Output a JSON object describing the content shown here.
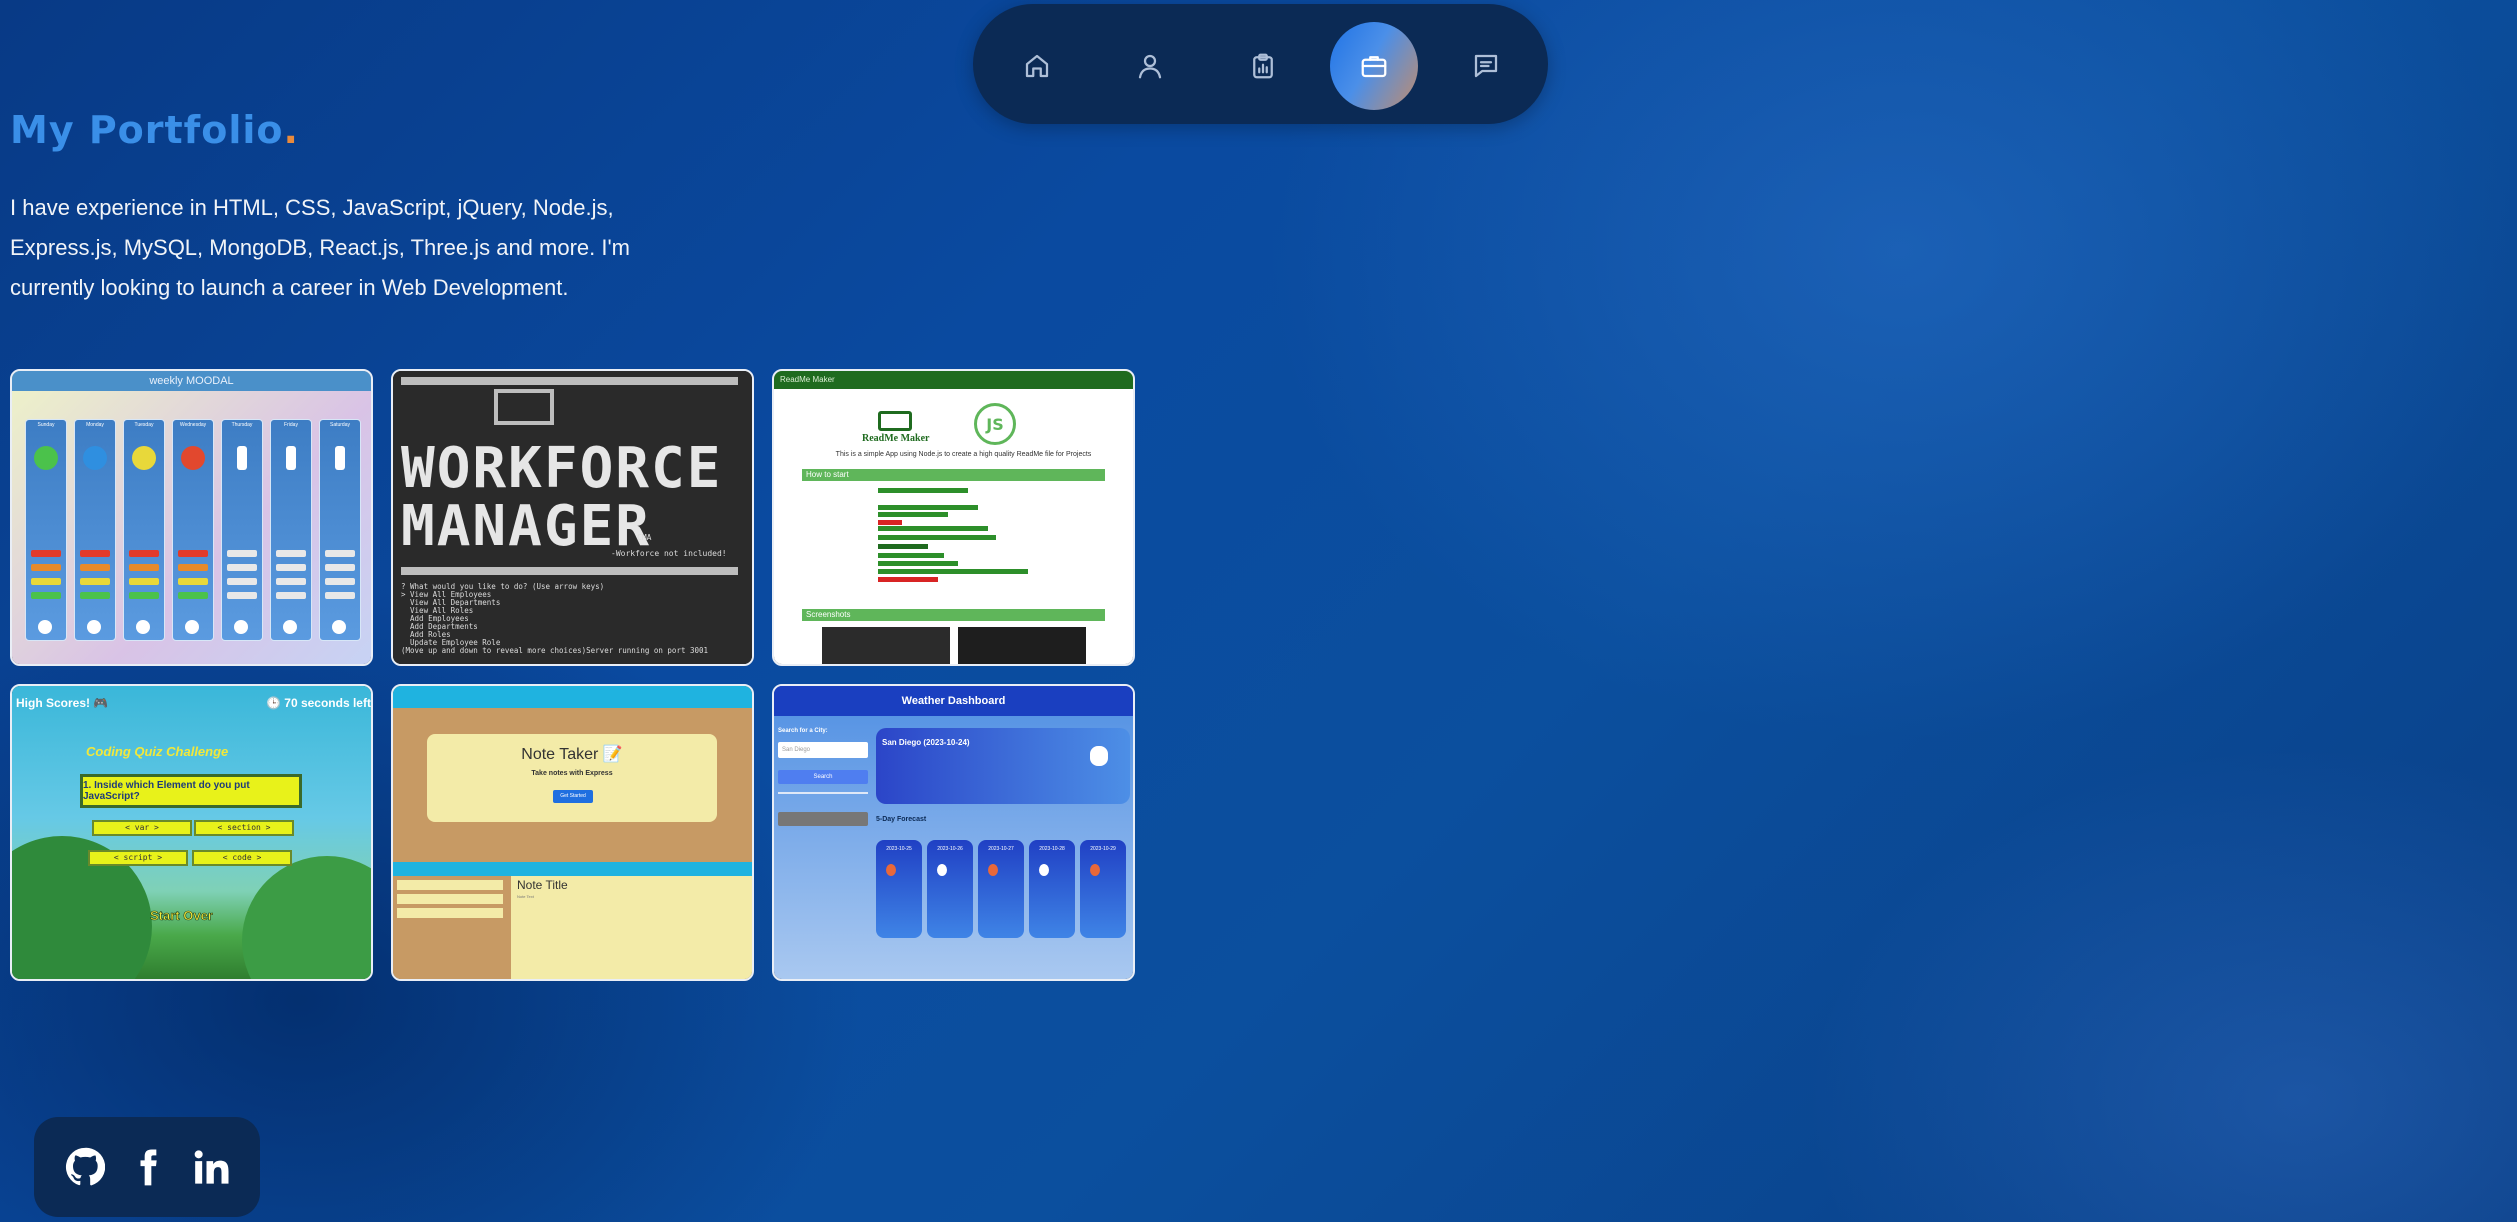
{
  "nav": {
    "items": [
      {
        "icon": "home-icon",
        "label": "Home"
      },
      {
        "icon": "user-icon",
        "label": "About"
      },
      {
        "icon": "clipboard-icon",
        "label": "Resume"
      },
      {
        "icon": "briefcase-icon",
        "label": "Portfolio",
        "active": true
      },
      {
        "icon": "message-icon",
        "label": "Contact"
      }
    ]
  },
  "header": {
    "title": "My Portfolio",
    "title_dot": "."
  },
  "intro": "I have experience in HTML, CSS, JavaScript, jQuery, Node.js, Express.js, MySQL, MongoDB, React.js, Three.js and more. I'm currently looking to launch a career in Web Development.",
  "projects": [
    {
      "name": "weekly MOODAL",
      "header": "weekly MOODAL",
      "days": [
        "Sunday",
        "Monday",
        "Tuesday",
        "Wednesday",
        "Thursday",
        "Friday",
        "Saturday"
      ]
    },
    {
      "name": "Workforce Manager",
      "line1": "WORKFORCE",
      "line2": "MANAGER",
      "tag": "CMA",
      "subtitle": "-Workforce not included!",
      "terminal": "? What would you like to do? (Use arrow keys)\n> View All Employees\n  View All Departments\n  View All Roles\n  Add Employees\n  Add Departments\n  Add Roles\n  Update Employee Role\n(Move up and down to reveal more choices)Server running on port 3001"
    },
    {
      "name": "ReadMe Maker",
      "topbar": "ReadMe Maker",
      "logo_text": "ReadMe Maker",
      "js_logo": "JS",
      "description": "This is a simple App using Node.js to create a high quality ReadMe file for Projects",
      "section1": "How to start",
      "section2": "Screenshots"
    },
    {
      "name": "Coding Quiz Challenge",
      "high_scores": "High Scores! 🎮",
      "timer": "🕒 70 seconds left",
      "quiz_title": "Coding Quiz Challenge",
      "question": "1. Inside which Element do you put JavaScript?",
      "options": [
        "< var >",
        "< section >",
        "< script >",
        "< code >"
      ],
      "restart": "Start Over"
    },
    {
      "name": "Note Taker",
      "heading": "Note Taker 📝",
      "subheading": "Take notes with Express",
      "button": "Get Started",
      "note_title": "Note Title",
      "note_text": "Note Text"
    },
    {
      "name": "Weather Dashboard",
      "heading": "Weather Dashboard",
      "search_label": "Search for a City:",
      "search_placeholder": "San Diego",
      "search_button": "Search",
      "city": "San Diego (2023-10-24)",
      "forecast_label": "5-Day Forecast",
      "forecast_dates": [
        "2023-10-25",
        "2023-10-26",
        "2023-10-27",
        "2023-10-28",
        "2023-10-29"
      ]
    }
  ],
  "social": [
    {
      "icon": "github-icon",
      "label": "GitHub"
    },
    {
      "icon": "facebook-icon",
      "label": "Facebook"
    },
    {
      "icon": "linkedin-icon",
      "label": "LinkedIn"
    }
  ],
  "colors": {
    "accent_blue": "#3a8fe8",
    "accent_orange": "#e98a3c",
    "nav_bg": "#0b2a55"
  }
}
